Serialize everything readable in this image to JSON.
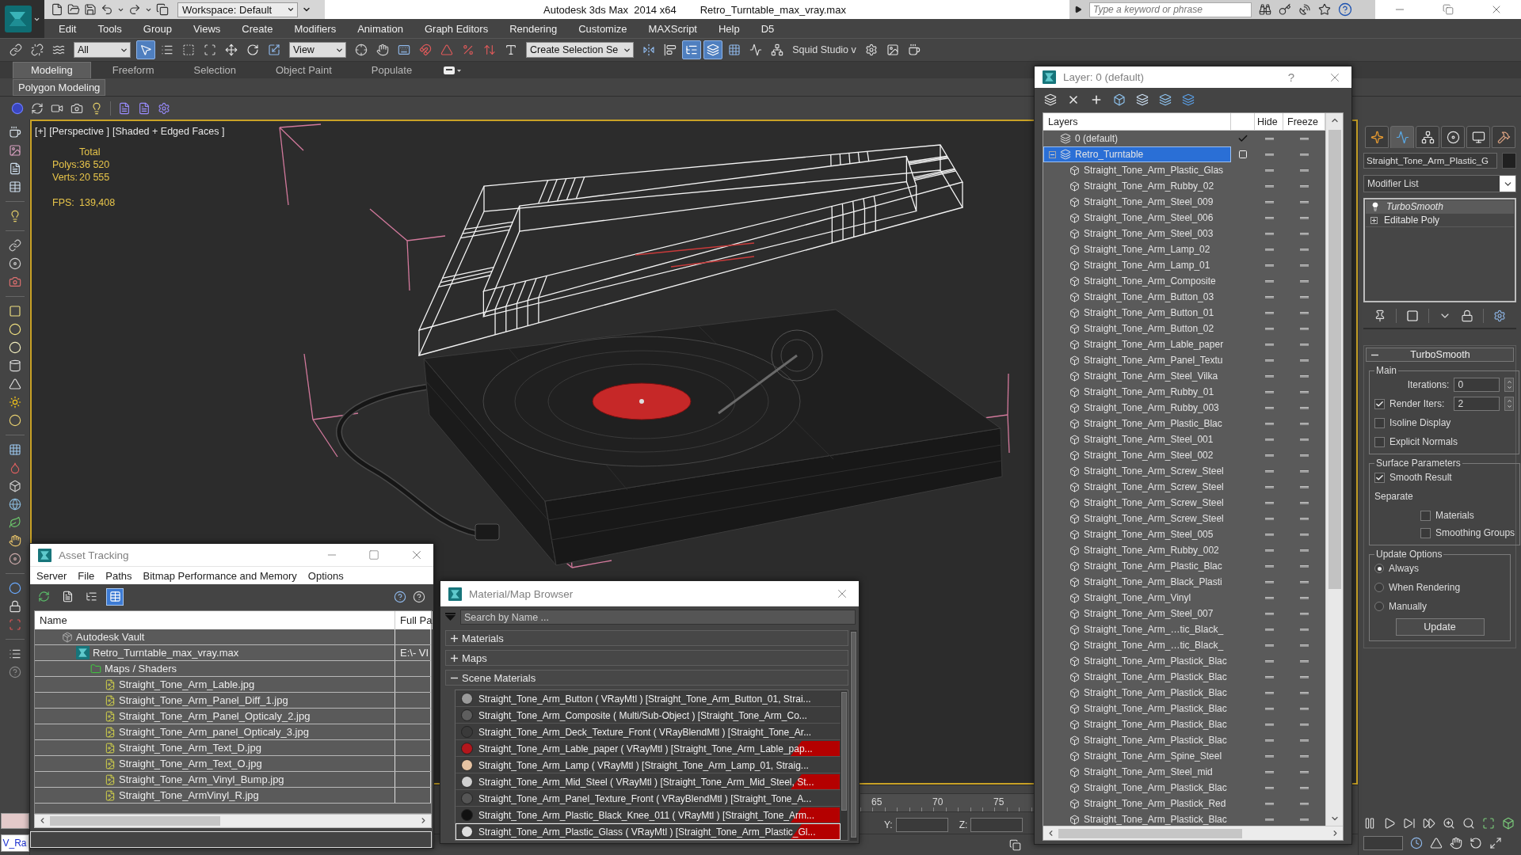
{
  "window": {
    "title": "Autodesk 3ds Max  2014 x64",
    "file": "Retro_Turntable_max_vray.max",
    "workspace": "Workspace: Default",
    "search": {
      "placeholder": "Type a keyword or phrase"
    }
  },
  "menu": [
    "Edit",
    "Tools",
    "Group",
    "Views",
    "Create",
    "Modifiers",
    "Animation",
    "Graph Editors",
    "Rendering",
    "Customize",
    "MAXScript",
    "Help",
    "D5"
  ],
  "toolbar": [
    {
      "kind": "link",
      "selected": false
    },
    {
      "kind": "unlink",
      "selected": false
    },
    {
      "kind": "bind",
      "selected": false
    },
    {
      "kind": "dropdown",
      "value": "All"
    },
    {
      "kind": "select",
      "selected": true
    },
    {
      "kind": "select_by_name",
      "selected": false
    },
    {
      "kind": "region",
      "selected": false
    },
    {
      "kind": "window_crossing",
      "selected": false
    },
    {
      "kind": "move",
      "selected": false
    },
    {
      "kind": "rotate",
      "selected": false
    },
    {
      "kind": "scale",
      "selected": false
    },
    {
      "kind": "dropdown",
      "value": "View"
    },
    {
      "kind": "pivot",
      "selected": false
    },
    {
      "kind": "manipulate",
      "selected": false
    },
    {
      "kind": "keyboard",
      "selected": false
    },
    {
      "kind": "snap",
      "selected": false
    },
    {
      "kind": "angle_snap",
      "selected": false
    },
    {
      "kind": "percent_snap",
      "selected": false
    },
    {
      "kind": "spinner_snap",
      "selected": false
    },
    {
      "kind": "named_sets",
      "selected": false
    },
    {
      "kind": "dropdown",
      "value": "Create Selection Se"
    },
    {
      "kind": "mirror",
      "selected": false
    },
    {
      "kind": "align",
      "selected": false
    },
    {
      "kind": "scene_explorer",
      "selected": true
    },
    {
      "kind": "layer_explorer",
      "selected": true
    },
    {
      "kind": "ribbon",
      "selected": false
    },
    {
      "kind": "curve_editor",
      "selected": false
    },
    {
      "kind": "schematic",
      "selected": false
    },
    {
      "kind": "label",
      "value": "Squid Studio v"
    },
    {
      "kind": "render_setup",
      "selected": false
    },
    {
      "kind": "frame_window",
      "selected": false
    },
    {
      "kind": "render",
      "selected": false
    }
  ],
  "ribbon": {
    "tabs": [
      {
        "label": "Modeling",
        "selected": true
      },
      {
        "label": "Freeform",
        "selected": false
      },
      {
        "label": "Selection",
        "selected": false
      },
      {
        "label": "Object Paint",
        "selected": false
      },
      {
        "label": "Populate",
        "selected": false
      }
    ],
    "panel": "Polygon Modeling"
  },
  "viewport": {
    "active": true,
    "labels": [
      "[+]",
      "[Perspective ]",
      "[Shaded + Edged Faces ]"
    ],
    "stats": {
      "heading": "Total",
      "rows": [
        {
          "label": "Polys:",
          "value": "36 520"
        },
        {
          "label": "Verts:",
          "value": "20 555"
        }
      ],
      "fps": {
        "label": "FPS:",
        "value": "139,408"
      }
    }
  },
  "timeline": {
    "ticks": [
      "65",
      "70",
      "75"
    ]
  },
  "status_bar": {
    "coordinates": [
      "Y:",
      "Z:"
    ],
    "listener": "V_Ra"
  },
  "command_panel": {
    "tabs": [
      {
        "kind": "create",
        "selected": false
      },
      {
        "kind": "modify",
        "selected": true
      },
      {
        "kind": "hierarchy",
        "selected": false
      },
      {
        "kind": "motion",
        "selected": false
      },
      {
        "kind": "display",
        "selected": false
      },
      {
        "kind": "utilities",
        "selected": false
      }
    ],
    "object_name": "Straight_Tone_Arm_Plastic_G",
    "modifier_list": "Modifier List",
    "stack": [
      {
        "name": "TurboSmooth",
        "kind": "modifier",
        "selected": true
      },
      {
        "name": "Editable Poly",
        "kind": "base",
        "selected": false
      }
    ],
    "rollout": {
      "title": "TurboSmooth",
      "expanded": true,
      "groups": [
        {
          "title": "Main",
          "controls": [
            {
              "kind": "spinner",
              "label": "Iterations:",
              "value": "0"
            },
            {
              "kind": "check_spinner",
              "label": "Render Iters:",
              "checked": true,
              "value": "2"
            },
            {
              "kind": "checkbox",
              "label": "Isoline Display",
              "checked": false
            },
            {
              "kind": "checkbox",
              "label": "Explicit Normals",
              "checked": false
            }
          ]
        },
        {
          "title": "Surface Parameters",
          "controls": [
            {
              "kind": "checkbox",
              "label": "Smooth Result",
              "checked": true
            },
            {
              "kind": "label",
              "label": "Separate",
              "children": [
                {
                  "kind": "checkbox",
                  "label": "Materials",
                  "checked": false
                },
                {
                  "kind": "checkbox",
                  "label": "Smoothing Groups",
                  "checked": false
                }
              ]
            }
          ]
        },
        {
          "title": "Update Options",
          "controls": [
            {
              "kind": "radio",
              "label": "Always",
              "selected": true
            },
            {
              "kind": "radio",
              "label": "When Rendering",
              "selected": false
            },
            {
              "kind": "radio",
              "label": "Manually",
              "selected": false
            },
            {
              "kind": "button",
              "label": "Update"
            }
          ]
        }
      ]
    }
  },
  "layer_window": {
    "title": "Layer: 0 (default)",
    "help": "?",
    "columns": {
      "name": "Layers",
      "hide": "Hide",
      "freeze": "Freeze"
    },
    "layers": [
      {
        "name": "0 (default)",
        "current": true,
        "selected": false
      },
      {
        "name": "Retro_Turntable",
        "current": false,
        "selected": true,
        "expanded": true,
        "children": [
          {
            "name": "Straight_Tone_Arm_Plastic_Glas",
            "selected": false
          },
          {
            "name": "Straight_Tone_Arm_Rubby_02",
            "selected": false
          },
          {
            "name": "Straight_Tone_Arm_Steel_009",
            "selected": false
          },
          {
            "name": "Straight_Tone_Arm_Steel_006",
            "selected": false
          },
          {
            "name": "Straight_Tone_Arm_Steel_003",
            "selected": false
          },
          {
            "name": "Straight_Tone_Arm_Lamp_02",
            "selected": false
          },
          {
            "name": "Straight_Tone_Arm_Lamp_01",
            "selected": false
          },
          {
            "name": "Straight_Tone_Arm_Composite",
            "selected": false
          },
          {
            "name": "Straight_Tone_Arm_Button_03",
            "selected": false
          },
          {
            "name": "Straight_Tone_Arm_Button_01",
            "selected": false
          },
          {
            "name": "Straight_Tone_Arm_Button_02",
            "selected": false
          },
          {
            "name": "Straight_Tone_Arm_Lable_paper",
            "selected": false
          },
          {
            "name": "Straight_Tone_Arm_Panel_Textu",
            "selected": false
          },
          {
            "name": "Straight_Tone_Arm_Steel_Vilka",
            "selected": false
          },
          {
            "name": "Straight_Tone_Arm_Rubby_01",
            "selected": false
          },
          {
            "name": "Straight_Tone_Arm_Rubby_003",
            "selected": false
          },
          {
            "name": "Straight_Tone_Arm_Plastic_Blac",
            "selected": false
          },
          {
            "name": "Straight_Tone_Arm_Steel_001",
            "selected": false
          },
          {
            "name": "Straight_Tone_Arm_Steel_002",
            "selected": false
          },
          {
            "name": "Straight_Tone_Arm_Screw_Steel",
            "selected": false
          },
          {
            "name": "Straight_Tone_Arm_Screw_Steel",
            "selected": false
          },
          {
            "name": "Straight_Tone_Arm_Screw_Steel",
            "selected": false
          },
          {
            "name": "Straight_Tone_Arm_Screw_Steel",
            "selected": false
          },
          {
            "name": "Straight_Tone_Arm_Steel_005",
            "selected": false
          },
          {
            "name": "Straight_Tone_Arm_Rubby_002",
            "selected": false
          },
          {
            "name": "Straight_Tone_Arm_Plastic_Blac",
            "selected": false
          },
          {
            "name": "Straight_Tone_Arm_Black_Plasti",
            "selected": false
          },
          {
            "name": "Straight_Tone_Arm_Vinyl",
            "selected": false
          },
          {
            "name": "Straight_Tone_Arm_Steel_007",
            "selected": false
          },
          {
            "name": "Straight_Tone_Arm_…tic_Black_",
            "selected": false
          },
          {
            "name": "Straight_Tone_Arm_…tic_Black_",
            "selected": false
          },
          {
            "name": "Straight_Tone_Arm_Plastick_Blac",
            "selected": false
          },
          {
            "name": "Straight_Tone_Arm_Plastick_Blac",
            "selected": false
          },
          {
            "name": "Straight_Tone_Arm_Plastick_Blac",
            "selected": false
          },
          {
            "name": "Straight_Tone_Arm_Plastick_Blac",
            "selected": false
          },
          {
            "name": "Straight_Tone_Arm_Plastick_Blac",
            "selected": false
          },
          {
            "name": "Straight_Tone_Arm_Plastick_Blac",
            "selected": false
          },
          {
            "name": "Straight_Tone_Arm_Spine_Steel",
            "selected": false
          },
          {
            "name": "Straight_Tone_Arm_Steel_mid",
            "selected": false
          },
          {
            "name": "Straight_Tone_Arm_Plastick_Blac",
            "selected": false
          },
          {
            "name": "Straight_Tone_Arm_Plastick_Red",
            "selected": false
          },
          {
            "name": "Straight_Tone_Arm_Plastick_Blac",
            "selected": false
          }
        ]
      }
    ]
  },
  "asset_tracking": {
    "title": "Asset Tracking",
    "menu": [
      "Server",
      "File",
      "Paths",
      "Bitmap Performance and Memory",
      "Options"
    ],
    "toolbar": [
      {
        "kind": "refresh",
        "selected": false
      },
      {
        "kind": "list",
        "selected": false
      },
      {
        "kind": "tree",
        "selected": false
      },
      {
        "kind": "table",
        "selected": true
      }
    ],
    "columns": [
      "Name",
      "Full Pa"
    ],
    "tree": [
      {
        "name": "Autodesk Vault",
        "kind": "vault",
        "children": [
          {
            "name": "Retro_Turntable_max_vray.max",
            "kind": "scene",
            "path": "E:\\- VI",
            "children": [
              {
                "name": "Maps / Shaders",
                "kind": "folder",
                "children": [
                  {
                    "name": "Straight_Tone_Arm_Lable.jpg",
                    "kind": "image"
                  },
                  {
                    "name": "Straight_Tone_Arm_Panel_Diff_1.jpg",
                    "kind": "image"
                  },
                  {
                    "name": "Straight_Tone_Arm_Panel_Opticaly_2.jpg",
                    "kind": "image"
                  },
                  {
                    "name": "Straight_Tone_Arm_panel_Opticaly_3.jpg",
                    "kind": "image"
                  },
                  {
                    "name": "Straight_Tone_Arm_Text_D.jpg",
                    "kind": "image"
                  },
                  {
                    "name": "Straight_Tone_Arm_Text_O.jpg",
                    "kind": "image"
                  },
                  {
                    "name": "Straight_Tone_Arm_Vinyl_Bump.jpg",
                    "kind": "image"
                  },
                  {
                    "name": "Straight_Tone_ArmVinyl_R.jpg",
                    "kind": "image"
                  }
                ]
              }
            ]
          }
        ]
      }
    ]
  },
  "material_browser": {
    "title": "Material/Map Browser",
    "search": {
      "placeholder": "Search by Name ..."
    },
    "groups": [
      {
        "title": "Materials",
        "expanded": false
      },
      {
        "title": "Maps",
        "expanded": false
      },
      {
        "title": "Scene Materials",
        "expanded": true,
        "items": [
          {
            "label": "Straight_Tone_Arm_Button ( VRayMtl ) [Straight_Tone_Arm_Button_01, Strai...",
            "color": "#9a9a9a",
            "marked": false,
            "selected": false
          },
          {
            "label": "Straight_Tone_Arm_Composite ( Multi/Sub-Object ) [Straight_Tone_Arm_Co...",
            "color": "#5e5e5e",
            "marked": false,
            "selected": false
          },
          {
            "label": "Straight_Tone_Arm_Deck_Texture_Front ( VRayBlendMtl ) [Straight_Tone_Ar...",
            "color": "#3a3a3a",
            "marked": false,
            "selected": false
          },
          {
            "label": "Straight_Tone_Arm_Lable_paper ( VRayMtl ) [Straight_Tone_Arm_Lable_pap...",
            "color": "#b3161c",
            "marked": true,
            "selected": false
          },
          {
            "label": "Straight_Tone_Arm_Lamp ( VRayMtl ) [Straight_Tone_Arm_Lamp_01, Straig...",
            "color": "#e6c3a3",
            "marked": false,
            "selected": false
          },
          {
            "label": "Straight_Tone_Arm_Mid_Steel ( VRayMtl ) [Straight_Tone_Arm_Mid_Steel, St...",
            "color": "#cfcfcf",
            "marked": true,
            "selected": false
          },
          {
            "label": "Straight_Tone_Arm_Panel_Texture_Front ( VRayBlendMtl ) [Straight_Tone_A...",
            "color": "#555555",
            "marked": false,
            "selected": false
          },
          {
            "label": "Straight_Tone_Arm_Plastic_Black_Knee_011 ( VRayMtl ) [Straight_Tone_Arm...",
            "color": "#111111",
            "marked": true,
            "selected": false
          },
          {
            "label": "Straight_Tone_Arm_Plastic_Glass ( VRayMtl ) [Straight_Tone_Arm_Plastic_Gl...",
            "color": "#dedede",
            "marked": true,
            "selected": true
          }
        ]
      }
    ]
  }
}
